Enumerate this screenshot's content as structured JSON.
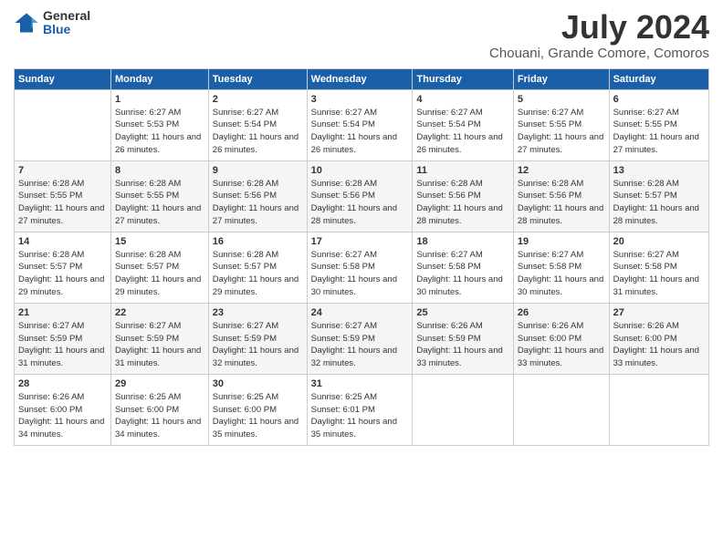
{
  "logo": {
    "general": "General",
    "blue": "Blue"
  },
  "title": "July 2024",
  "location": "Chouani, Grande Comore, Comoros",
  "days_of_week": [
    "Sunday",
    "Monday",
    "Tuesday",
    "Wednesday",
    "Thursday",
    "Friday",
    "Saturday"
  ],
  "weeks": [
    [
      {
        "day": "",
        "info": ""
      },
      {
        "day": "1",
        "info": "Sunrise: 6:27 AM\nSunset: 5:53 PM\nDaylight: 11 hours and 26 minutes."
      },
      {
        "day": "2",
        "info": "Sunrise: 6:27 AM\nSunset: 5:54 PM\nDaylight: 11 hours and 26 minutes."
      },
      {
        "day": "3",
        "info": "Sunrise: 6:27 AM\nSunset: 5:54 PM\nDaylight: 11 hours and 26 minutes."
      },
      {
        "day": "4",
        "info": "Sunrise: 6:27 AM\nSunset: 5:54 PM\nDaylight: 11 hours and 26 minutes."
      },
      {
        "day": "5",
        "info": "Sunrise: 6:27 AM\nSunset: 5:55 PM\nDaylight: 11 hours and 27 minutes."
      },
      {
        "day": "6",
        "info": "Sunrise: 6:27 AM\nSunset: 5:55 PM\nDaylight: 11 hours and 27 minutes."
      }
    ],
    [
      {
        "day": "7",
        "info": "Sunrise: 6:28 AM\nSunset: 5:55 PM\nDaylight: 11 hours and 27 minutes."
      },
      {
        "day": "8",
        "info": "Sunrise: 6:28 AM\nSunset: 5:55 PM\nDaylight: 11 hours and 27 minutes."
      },
      {
        "day": "9",
        "info": "Sunrise: 6:28 AM\nSunset: 5:56 PM\nDaylight: 11 hours and 27 minutes."
      },
      {
        "day": "10",
        "info": "Sunrise: 6:28 AM\nSunset: 5:56 PM\nDaylight: 11 hours and 28 minutes."
      },
      {
        "day": "11",
        "info": "Sunrise: 6:28 AM\nSunset: 5:56 PM\nDaylight: 11 hours and 28 minutes."
      },
      {
        "day": "12",
        "info": "Sunrise: 6:28 AM\nSunset: 5:56 PM\nDaylight: 11 hours and 28 minutes."
      },
      {
        "day": "13",
        "info": "Sunrise: 6:28 AM\nSunset: 5:57 PM\nDaylight: 11 hours and 28 minutes."
      }
    ],
    [
      {
        "day": "14",
        "info": "Sunrise: 6:28 AM\nSunset: 5:57 PM\nDaylight: 11 hours and 29 minutes."
      },
      {
        "day": "15",
        "info": "Sunrise: 6:28 AM\nSunset: 5:57 PM\nDaylight: 11 hours and 29 minutes."
      },
      {
        "day": "16",
        "info": "Sunrise: 6:28 AM\nSunset: 5:57 PM\nDaylight: 11 hours and 29 minutes."
      },
      {
        "day": "17",
        "info": "Sunrise: 6:27 AM\nSunset: 5:58 PM\nDaylight: 11 hours and 30 minutes."
      },
      {
        "day": "18",
        "info": "Sunrise: 6:27 AM\nSunset: 5:58 PM\nDaylight: 11 hours and 30 minutes."
      },
      {
        "day": "19",
        "info": "Sunrise: 6:27 AM\nSunset: 5:58 PM\nDaylight: 11 hours and 30 minutes."
      },
      {
        "day": "20",
        "info": "Sunrise: 6:27 AM\nSunset: 5:58 PM\nDaylight: 11 hours and 31 minutes."
      }
    ],
    [
      {
        "day": "21",
        "info": "Sunrise: 6:27 AM\nSunset: 5:59 PM\nDaylight: 11 hours and 31 minutes."
      },
      {
        "day": "22",
        "info": "Sunrise: 6:27 AM\nSunset: 5:59 PM\nDaylight: 11 hours and 31 minutes."
      },
      {
        "day": "23",
        "info": "Sunrise: 6:27 AM\nSunset: 5:59 PM\nDaylight: 11 hours and 32 minutes."
      },
      {
        "day": "24",
        "info": "Sunrise: 6:27 AM\nSunset: 5:59 PM\nDaylight: 11 hours and 32 minutes."
      },
      {
        "day": "25",
        "info": "Sunrise: 6:26 AM\nSunset: 5:59 PM\nDaylight: 11 hours and 33 minutes."
      },
      {
        "day": "26",
        "info": "Sunrise: 6:26 AM\nSunset: 6:00 PM\nDaylight: 11 hours and 33 minutes."
      },
      {
        "day": "27",
        "info": "Sunrise: 6:26 AM\nSunset: 6:00 PM\nDaylight: 11 hours and 33 minutes."
      }
    ],
    [
      {
        "day": "28",
        "info": "Sunrise: 6:26 AM\nSunset: 6:00 PM\nDaylight: 11 hours and 34 minutes."
      },
      {
        "day": "29",
        "info": "Sunrise: 6:25 AM\nSunset: 6:00 PM\nDaylight: 11 hours and 34 minutes."
      },
      {
        "day": "30",
        "info": "Sunrise: 6:25 AM\nSunset: 6:00 PM\nDaylight: 11 hours and 35 minutes."
      },
      {
        "day": "31",
        "info": "Sunrise: 6:25 AM\nSunset: 6:01 PM\nDaylight: 11 hours and 35 minutes."
      },
      {
        "day": "",
        "info": ""
      },
      {
        "day": "",
        "info": ""
      },
      {
        "day": "",
        "info": ""
      }
    ]
  ]
}
